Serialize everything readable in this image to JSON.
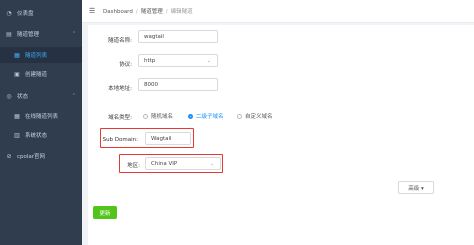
{
  "sidebar": {
    "items": [
      {
        "icon": "dashboard-icon",
        "label": "仪表盘"
      },
      {
        "icon": "tunnel-icon",
        "label": "隧道管理"
      },
      {
        "icon": "list-icon",
        "label": "隧道列表"
      },
      {
        "icon": "plus-icon",
        "label": "创建隧道"
      },
      {
        "icon": "status-icon",
        "label": "状态"
      },
      {
        "icon": "list-icon",
        "label": "在线隧道列表"
      },
      {
        "icon": "status-icon",
        "label": "系统状态"
      },
      {
        "icon": "link-icon",
        "label": "cpolar官网"
      }
    ]
  },
  "breadcrumb": {
    "home": "Dashboard",
    "section": "隧道管理",
    "current": "编辑隧道"
  },
  "form": {
    "tunnel_name_label": "隧道名称:",
    "tunnel_name_value": "wagtail",
    "protocol_label": "协议:",
    "protocol_value": "http",
    "local_address_label": "本地地址:",
    "local_address_value": "8000",
    "domain_type_label": "域名类型:",
    "domain_type_options": [
      "随机域名",
      "二级子域名",
      "自定义域名"
    ],
    "domain_type_selected": "二级子域名",
    "subdomain_label": "Sub Domain:",
    "subdomain_value": "Wagtail",
    "region_label": "地区:",
    "region_value": "China VIP",
    "advanced_label": "高级 ▾",
    "update_label": "更新"
  },
  "colors": {
    "sidebar": "#2f3d4f",
    "accent": "#1890ff",
    "highlight": "#e53935",
    "update": "#52c41a"
  }
}
